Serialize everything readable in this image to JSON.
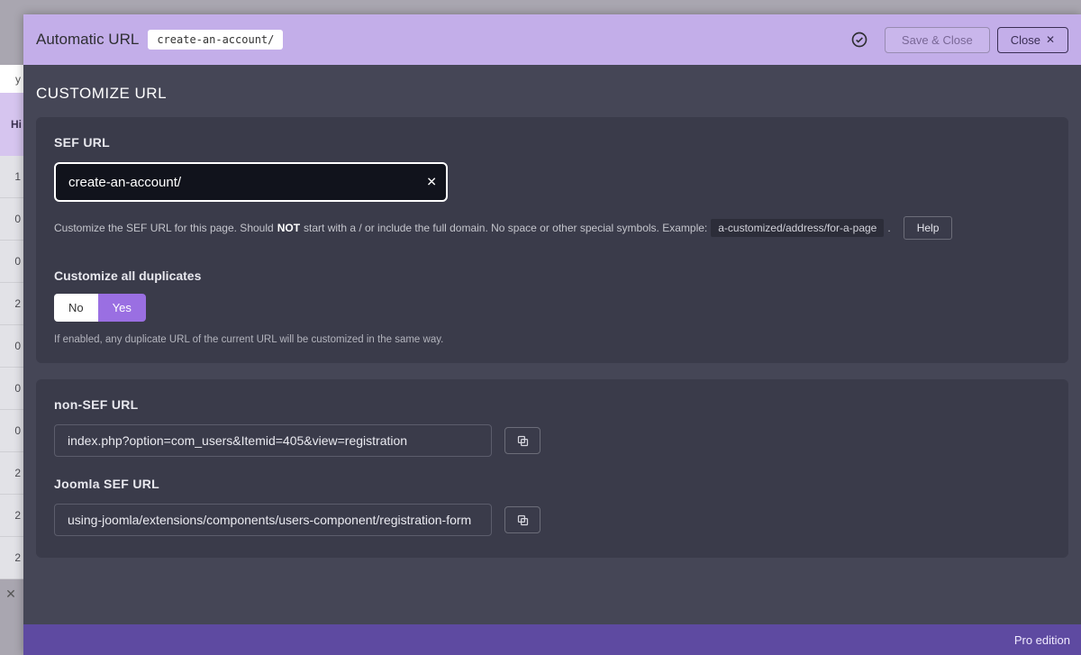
{
  "header": {
    "title": "Automatic URL",
    "chip": "create-an-account/",
    "save_label": "Save & Close",
    "close_label": "Close"
  },
  "section_title": "CUSTOMIZE URL",
  "sef": {
    "label": "SEF URL",
    "value": "create-an-account/",
    "hint_pre": "Customize the SEF URL for this page. Should ",
    "hint_not": "NOT",
    "hint_post": " start with a / or include the full domain. No space or other special symbols. Example: ",
    "hint_code": "a-customized/address/for-a-page",
    "hint_tail": ".",
    "help_label": "Help"
  },
  "dup": {
    "label": "Customize all duplicates",
    "no": "No",
    "yes": "Yes",
    "hint": "If enabled, any duplicate URL of the current URL will be customized in the same way."
  },
  "nonsef": {
    "label": "non-SEF URL",
    "value": "index.php?option=com_users&Itemid=405&view=registration"
  },
  "joomla": {
    "label": "Joomla SEF URL",
    "value": "using-joomla/extensions/components/users-component/registration-form"
  },
  "footer": "Pro edition",
  "bg": {
    "top1": "y",
    "top2": "Hi",
    "cells": [
      "1",
      "0",
      "0",
      "2",
      "0",
      "0",
      "0",
      "2",
      "2",
      "2"
    ]
  }
}
